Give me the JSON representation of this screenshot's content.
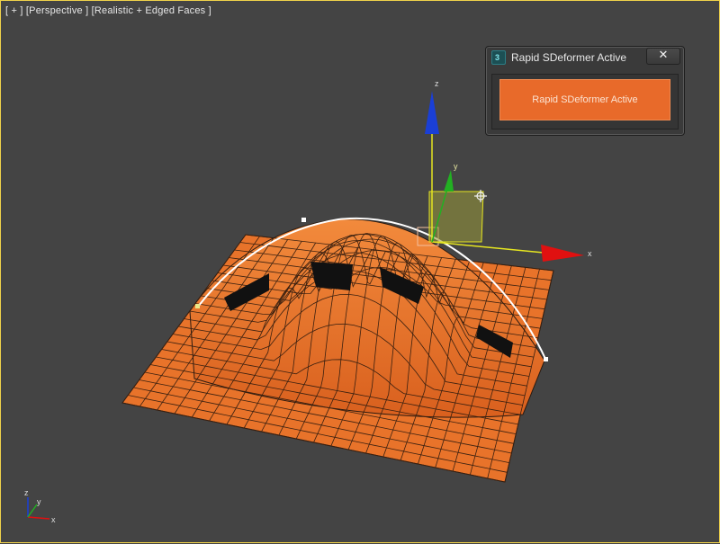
{
  "viewport": {
    "label": "[ + ] [Perspective ] [Realistic + Edged Faces ]",
    "colors": {
      "background": "#444444",
      "mesh": "#e8732a",
      "active_border": "#f0d24a"
    }
  },
  "gizmo": {
    "x_label": "x",
    "y_label": "y",
    "z_label": "z",
    "colors": {
      "x": "#e01010",
      "y": "#22b022",
      "z": "#1a3fd6",
      "plane": "#c8c84a"
    }
  },
  "dialog": {
    "title": "Rapid SDeformer Active",
    "close_glyph": "✕",
    "action_label": "Rapid SDeformer Active",
    "accent": "#e86a2a"
  },
  "corner_axes": {
    "x_label": "x",
    "y_label": "y",
    "z_label": "z"
  }
}
